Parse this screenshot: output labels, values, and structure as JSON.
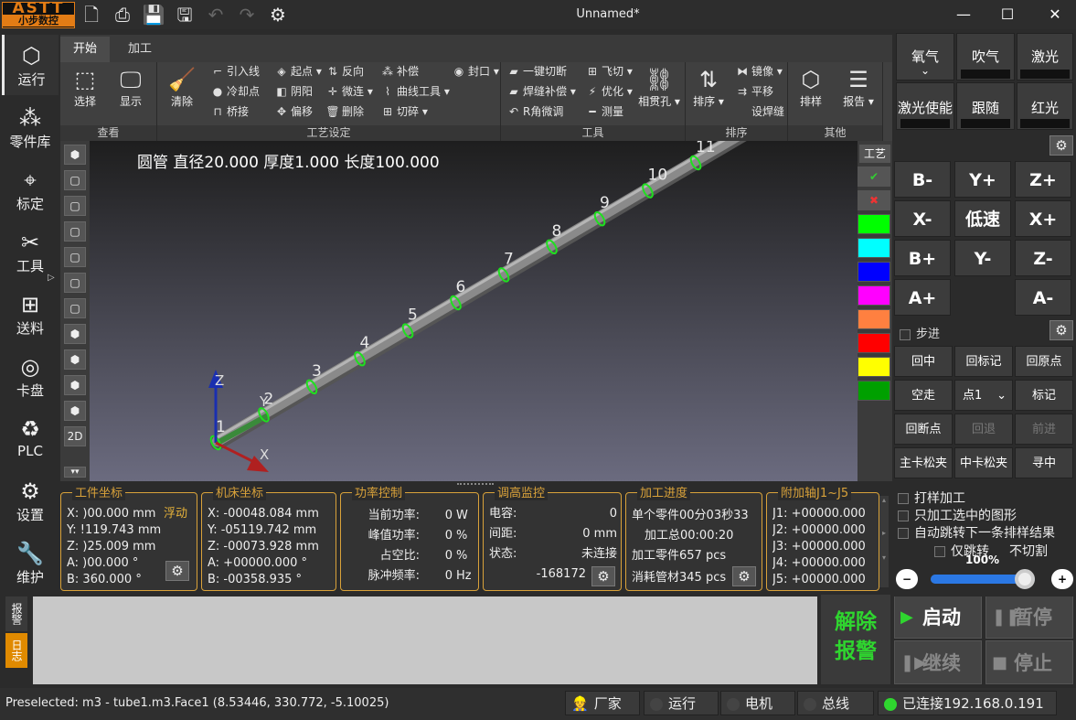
{
  "app": {
    "logo_top": "ASTT",
    "logo_bottom": "小步数控",
    "title": "Unnamed*"
  },
  "quick_toolbar": [
    "new-file-icon",
    "print-icon",
    "save-icon",
    "save-as-icon",
    "undo-icon",
    "redo-icon",
    "gear-icon"
  ],
  "window_controls": {
    "minimize": "—",
    "maximize": "☐",
    "close": "✕"
  },
  "left_nav": [
    {
      "label": "运行",
      "icon": "cube-icon"
    },
    {
      "label": "零件库",
      "icon": "grid-icon"
    },
    {
      "label": "标定",
      "icon": "target-icon"
    },
    {
      "label": "工具",
      "icon": "tools-icon"
    },
    {
      "label": "送料",
      "icon": "feed-icon"
    },
    {
      "label": "卡盘",
      "icon": "chuck-icon"
    },
    {
      "label": "PLC",
      "icon": "plc-icon"
    },
    {
      "label": "设置",
      "icon": "gear-icon"
    },
    {
      "label": "维护",
      "icon": "wrench-icon"
    }
  ],
  "tabs": [
    {
      "label": "开始",
      "active": true
    },
    {
      "label": "加工",
      "active": false
    }
  ],
  "ribbon": {
    "view": {
      "group": "查看",
      "select": "选择",
      "display": "显示"
    },
    "process": {
      "group": "工艺设定",
      "clear": "清除",
      "items": {
        "lead_line": "引入线",
        "cool_point": "冷却点",
        "bridge": "桥接",
        "start_point": "起点",
        "yin_yang": "阴阳",
        "offset": "偏移",
        "reverse": "反向",
        "micro_joint": "微连",
        "delete": "删除",
        "compensation": "补偿",
        "curve_tool": "曲线工具",
        "cut": "切碎",
        "seal": "封口"
      }
    },
    "tools": {
      "group": "工具",
      "items": {
        "one_key_cut": "一键切断",
        "weld_comp": "焊缝补偿",
        "r_corner": "R角微调",
        "fly_cut": "飞切",
        "optimize": "优化",
        "measure": "测量",
        "through_hole": "相贯孔"
      }
    },
    "sort": {
      "group": "排序",
      "sort": "排序",
      "mirror": "镜像",
      "translate": "平移",
      "set_weld": "设焊缝"
    },
    "other": {
      "group": "其他",
      "nest": "排样",
      "report": "报告"
    }
  },
  "view_buttons": [
    "iso-cube-icon",
    "front-icon",
    "back-icon",
    "left-icon",
    "right-icon",
    "top-icon",
    "bottom-icon",
    "iso2-icon",
    "iso3-icon",
    "iso4-icon",
    "iso5-icon",
    "2D",
    "chevron-down-icon"
  ],
  "viewport": {
    "tube_info": "圆管 直径20.000 厚度1.000 长度100.000",
    "part_numbers": [
      "1",
      "2",
      "3",
      "4",
      "5",
      "6",
      "7",
      "8",
      "9",
      "10",
      "11"
    ],
    "axes": {
      "x": "X",
      "y": "Y",
      "z": "Z"
    }
  },
  "craft_panel": {
    "label": "工艺",
    "colors": [
      "#00ff00",
      "#00ffff",
      "#0000ff",
      "#ff00ff",
      "#ff8040",
      "#ff0000",
      "#ffff00",
      "#00a000"
    ]
  },
  "panels": {
    "work_coord": {
      "title": "工件坐标",
      "rows": [
        "X: )00.000 mm",
        "Y: !119.743 mm",
        "Z: )25.009 mm",
        "A: )00.000 °",
        "B: 360.000 °"
      ],
      "float_label": "浮动"
    },
    "machine_coord": {
      "title": "机床坐标",
      "rows": [
        "X:  -00048.084 mm",
        "Y:  -05119.742 mm",
        "Z:  -00073.928 mm",
        "A: +00000.000 °",
        "B:  -00358.935 °"
      ]
    },
    "power": {
      "title": "功率控制",
      "rows": [
        {
          "label": "当前功率:",
          "value": "0",
          "unit": "W"
        },
        {
          "label": "峰值功率:",
          "value": "0",
          "unit": "%"
        },
        {
          "label": "占空比:",
          "value": "0",
          "unit": "%"
        },
        {
          "label": "脉冲频率:",
          "value": "0",
          "unit": "Hz"
        }
      ]
    },
    "height_monitor": {
      "title": "调高监控",
      "rows": [
        {
          "label": "电容:",
          "value": "0"
        },
        {
          "label": "间距:",
          "value": "0 mm"
        },
        {
          "label": "状态:",
          "value": "未连接"
        }
      ],
      "reading": "-168172"
    },
    "progress": {
      "title": "加工进度",
      "rows": [
        "单个零件00分03秒33",
        "加工总00:00:20",
        "加工零件657 pcs",
        "消耗管材345 pcs"
      ]
    },
    "aux_axes": {
      "title": "附加轴J1~J5",
      "rows": [
        "J1: +00000.000",
        "J2: +00000.000",
        "J3: +00000.000",
        "J4: +00000.000",
        "J5: +00000.000"
      ]
    }
  },
  "log_tabs": [
    "报警",
    "日志"
  ],
  "alarm_clear": {
    "line1": "解除",
    "line2": "报警"
  },
  "run_buttons": {
    "start": "启动",
    "pause": "暂停",
    "resume": "继续",
    "stop": "停止"
  },
  "status": {
    "preselected": "Preselected: m3 - tube1.m3.Face1 (8.53446, 330.772, -5.10025)",
    "vendor": "厂家",
    "run": "运行",
    "motor": "电机",
    "bus": "总线",
    "connected": "已连接192.168.0.191"
  },
  "right_panel": {
    "gas": [
      {
        "label": "氧气",
        "sub": "⌄"
      },
      {
        "label": "吹气"
      },
      {
        "label": "激光"
      }
    ],
    "laser": [
      {
        "label": "激光使能"
      },
      {
        "label": "跟随"
      },
      {
        "label": "红光"
      }
    ],
    "jog": [
      [
        "B-",
        "Y+",
        "Z+"
      ],
      [
        "X-",
        "低速",
        "X+"
      ],
      [
        "B+",
        "Y-",
        "Z-"
      ],
      [
        "A+",
        "",
        "A-"
      ]
    ],
    "step_label": "步进",
    "nav_row1": [
      "回中",
      "回标记",
      "回原点"
    ],
    "nav_row2": {
      "empty_move": "空走",
      "point_select": "点1",
      "mark": "标记"
    },
    "nav_row3": [
      "回断点",
      "回退",
      "前进"
    ],
    "nav_row4": [
      "主卡松夹",
      "中卡松夹",
      "寻中"
    ],
    "options": [
      "打样加工",
      "只加工选中的图形",
      "自动跳转下一条排样结果"
    ],
    "rotate_only": "仅跳转",
    "no_cut": "不切割",
    "speed_percent": "100%",
    "speed_level": 1.0
  }
}
